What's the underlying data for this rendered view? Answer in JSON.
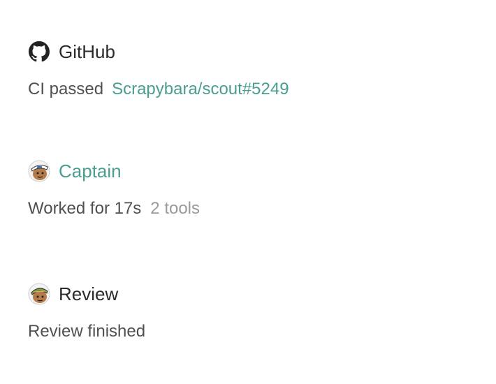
{
  "colors": {
    "accent": "#4a9e90",
    "text": "#505050",
    "muted": "#9a9a9a",
    "heading": "#2b2b2b"
  },
  "events": [
    {
      "icon": "github-icon",
      "title": "GitHub",
      "status": "CI passed",
      "link": "Scrapybara/scout#5249"
    },
    {
      "icon": "captain-avatar",
      "title": "Captain",
      "status": "Worked for 17s",
      "detail": "2 tools"
    },
    {
      "icon": "review-avatar",
      "title": "Review",
      "status": "Review finished"
    }
  ]
}
